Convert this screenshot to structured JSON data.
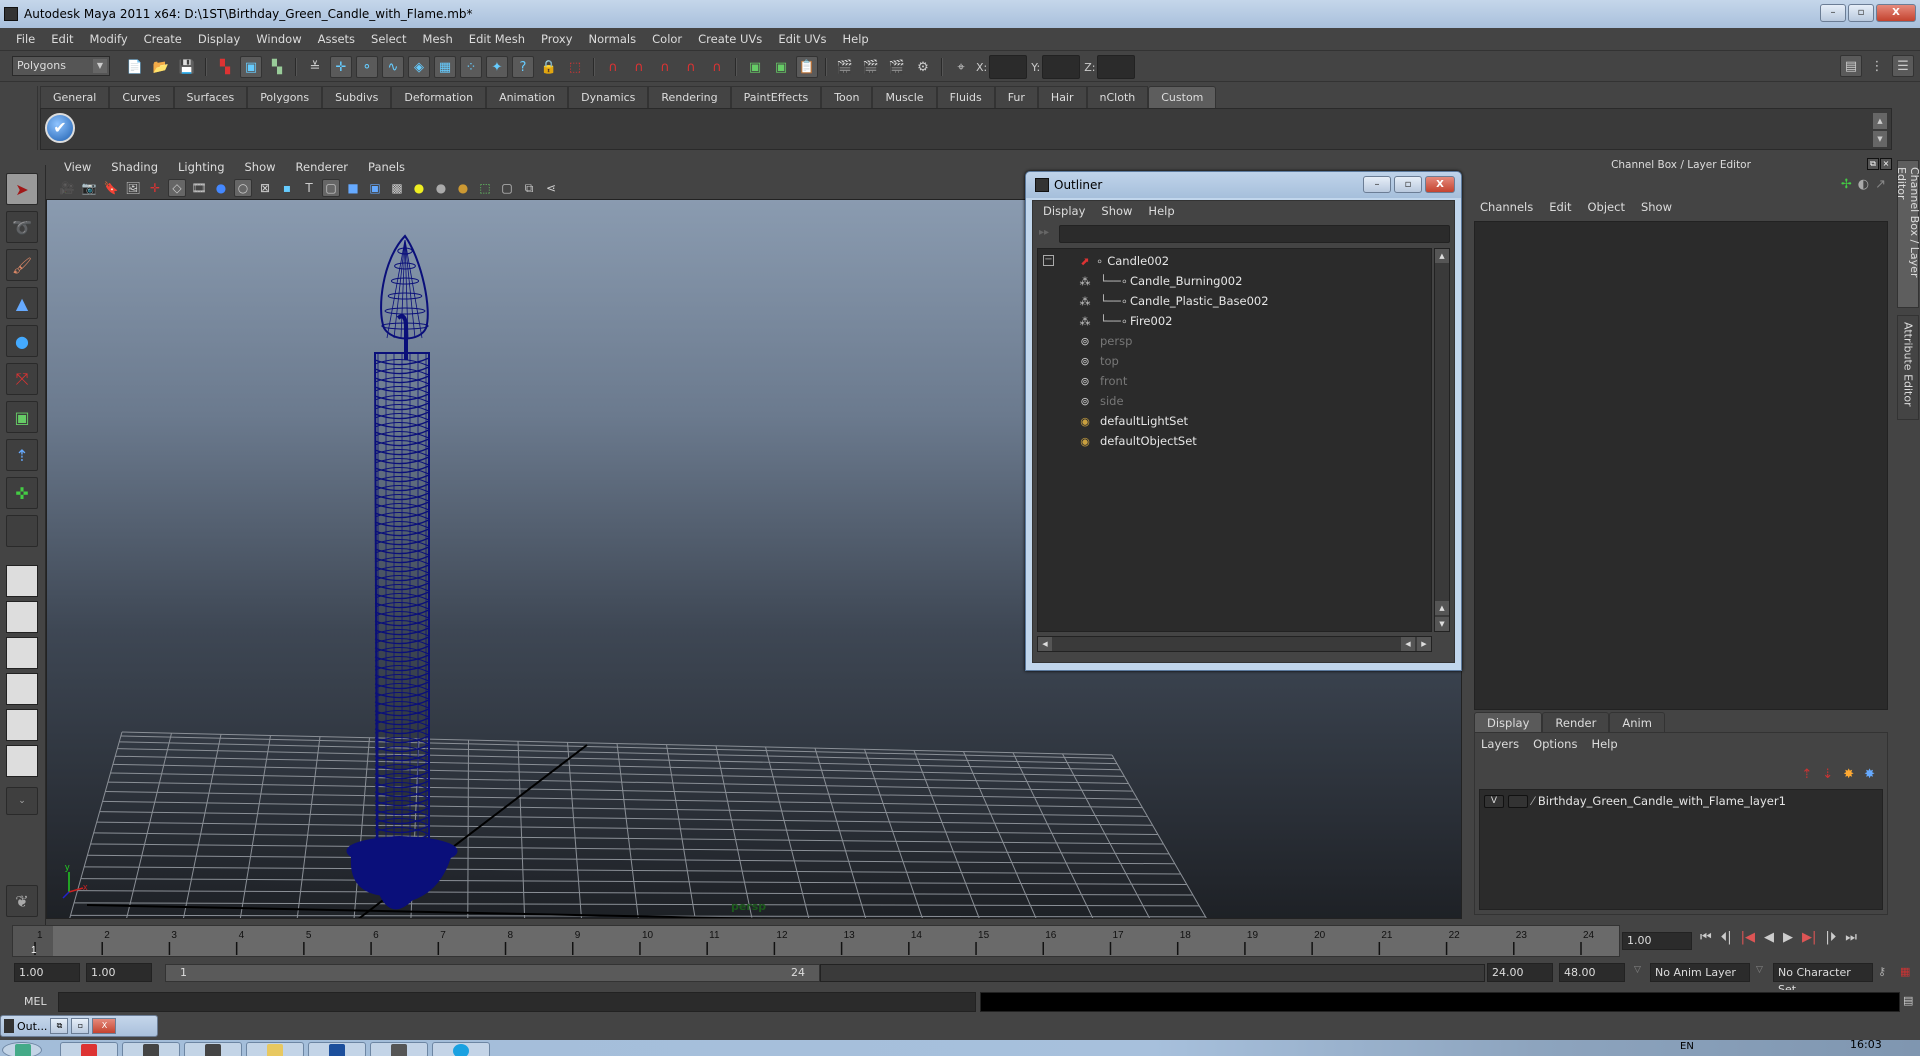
{
  "window": {
    "title": "Autodesk Maya 2011 x64: D:\\1ST\\Birthday_Green_Candle_with_Flame.mb*",
    "minimize": "–",
    "maximize": "▫",
    "close": "X"
  },
  "menubar": [
    "File",
    "Edit",
    "Modify",
    "Create",
    "Display",
    "Window",
    "Assets",
    "Select",
    "Mesh",
    "Edit Mesh",
    "Proxy",
    "Normals",
    "Color",
    "Create UVs",
    "Edit UVs",
    "Help"
  ],
  "statusline": {
    "mode": "Polygons",
    "coord_labels": {
      "x": "X:",
      "y": "Y:",
      "z": "Z:"
    },
    "x_value": "",
    "y_value": "",
    "z_value": ""
  },
  "shelf": {
    "tabs": [
      "General",
      "Curves",
      "Surfaces",
      "Polygons",
      "Subdivs",
      "Deformation",
      "Animation",
      "Dynamics",
      "Rendering",
      "PaintEffects",
      "Toon",
      "Muscle",
      "Fluids",
      "Fur",
      "Hair",
      "nCloth",
      "Custom"
    ],
    "active_tab": "Custom",
    "items": [
      {
        "icon": "checkmark-icon",
        "glyph": "✔"
      }
    ]
  },
  "viewport": {
    "menu": [
      "View",
      "Shading",
      "Lighting",
      "Show",
      "Renderer",
      "Panels"
    ],
    "camera_label": "persp",
    "wireframe_color": "#0a0f7a"
  },
  "outliner": {
    "title": "Outliner",
    "menu": [
      "Display",
      "Show",
      "Help"
    ],
    "filter_value": "",
    "items": [
      {
        "label": "Candle002",
        "type": "transform",
        "depth": 0,
        "dim": false,
        "expanded": true
      },
      {
        "label": "Candle_Burning002",
        "type": "mesh",
        "depth": 1,
        "dim": false
      },
      {
        "label": "Candle_Plastic_Base002",
        "type": "mesh",
        "depth": 1,
        "dim": false
      },
      {
        "label": "Fire002",
        "type": "mesh",
        "depth": 1,
        "dim": false
      },
      {
        "label": "persp",
        "type": "camera",
        "depth": 0,
        "dim": true
      },
      {
        "label": "top",
        "type": "camera",
        "depth": 0,
        "dim": true
      },
      {
        "label": "front",
        "type": "camera",
        "depth": 0,
        "dim": true
      },
      {
        "label": "side",
        "type": "camera",
        "depth": 0,
        "dim": true
      },
      {
        "label": "defaultLightSet",
        "type": "set",
        "depth": 0,
        "dim": false
      },
      {
        "label": "defaultObjectSet",
        "type": "set",
        "depth": 0,
        "dim": false
      }
    ]
  },
  "channelbox": {
    "title": "Channel Box / Layer Editor",
    "menu": [
      "Channels",
      "Edit",
      "Object",
      "Show"
    ]
  },
  "sidetabs": [
    "Channel Box / Layer Editor",
    "Attribute Editor"
  ],
  "layereditor": {
    "tabs": [
      "Display",
      "Render",
      "Anim"
    ],
    "active_tab": "Display",
    "menu": [
      "Layers",
      "Options",
      "Help"
    ],
    "layers": [
      {
        "visible": "V",
        "name": "Birthday_Green_Candle_with_Flame_layer1"
      }
    ]
  },
  "timeline": {
    "ticks": [
      "1",
      "2",
      "3",
      "4",
      "5",
      "6",
      "7",
      "8",
      "9",
      "10",
      "11",
      "12",
      "13",
      "14",
      "15",
      "16",
      "17",
      "18",
      "19",
      "20",
      "21",
      "22",
      "23",
      "24"
    ],
    "current_frame_label": "1",
    "current_frame": "1.00"
  },
  "range": {
    "start_time": "1.00",
    "playback_start": "1.00",
    "slider_start": "1",
    "slider_end": "24",
    "playback_end": "24.00",
    "end_time": "48.00",
    "anim_layer": "No Anim Layer",
    "character_set": "No Character Set"
  },
  "mel": {
    "label": "MEL",
    "command": "",
    "output": ""
  },
  "minimized_window": {
    "label": "Out..."
  },
  "taskbar": {
    "tray_lang": "EN",
    "clock": "16:03"
  }
}
